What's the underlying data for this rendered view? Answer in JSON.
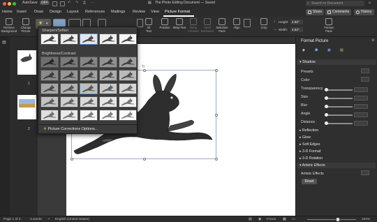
{
  "titlebar": {
    "autosave_label": "AutoSave",
    "autosave_state": "OFF",
    "doc_title": "The Photo Editing Document — Saved",
    "search_placeholder": "Search in Document"
  },
  "tabs": [
    {
      "label": "Home"
    },
    {
      "label": "Insert"
    },
    {
      "label": "Draw"
    },
    {
      "label": "Design"
    },
    {
      "label": "Layout"
    },
    {
      "label": "References"
    },
    {
      "label": "Mailings"
    },
    {
      "label": "Review"
    },
    {
      "label": "View"
    },
    {
      "label": "Picture Format"
    }
  ],
  "tab_actions": {
    "share": "Share",
    "comments": "Comments",
    "history": "History"
  },
  "ribbon": {
    "remove_bg": "Remove Background",
    "change_picture": "Change Picture",
    "alt_text": "Alt Text",
    "position": "Position",
    "wrap_text": "Wrap Text",
    "bring_forward": "Bring Forward",
    "send_backward": "Send Backward",
    "selection_pane": "Selection Pane",
    "align": "Align",
    "crop": "Crop",
    "height_label": "Height:",
    "height_value": "2.83\"",
    "width_label": "Width:",
    "width_value": "4.84\"",
    "format_pane": "Format Pane"
  },
  "dropdown": {
    "sharpen_header": "Sharpen/Soften",
    "brightness_header": "Brightness/Contrast",
    "options_link": "Picture Corrections Options..."
  },
  "pages": [
    {
      "num": "1"
    },
    {
      "num": "2"
    }
  ],
  "pane": {
    "title": "Format Picture",
    "shadow": "Shadow",
    "presets": "Presets",
    "color": "Color",
    "transparency": "Transparency",
    "size": "Size",
    "blur": "Blur",
    "angle": "Angle",
    "distance": "Distance",
    "reflection": "Reflection",
    "glow": "Glow",
    "soft_edges": "Soft Edges",
    "format_3d": "3-D Format",
    "rotation_3d": "3-D Rotation",
    "artistic_effects": "Artistic Effects",
    "artistic_effects_label": "Artistic Effects",
    "reset": "Reset"
  },
  "status": {
    "page": "Page 1 of 2",
    "words": "0 words",
    "language": "English (United States)",
    "focus": "Focus",
    "zoom": "152%"
  },
  "colors": {
    "accent_blue": "#5a8de0",
    "ribbon_bg": "#2f2f2f",
    "page_white": "#ffffff"
  }
}
